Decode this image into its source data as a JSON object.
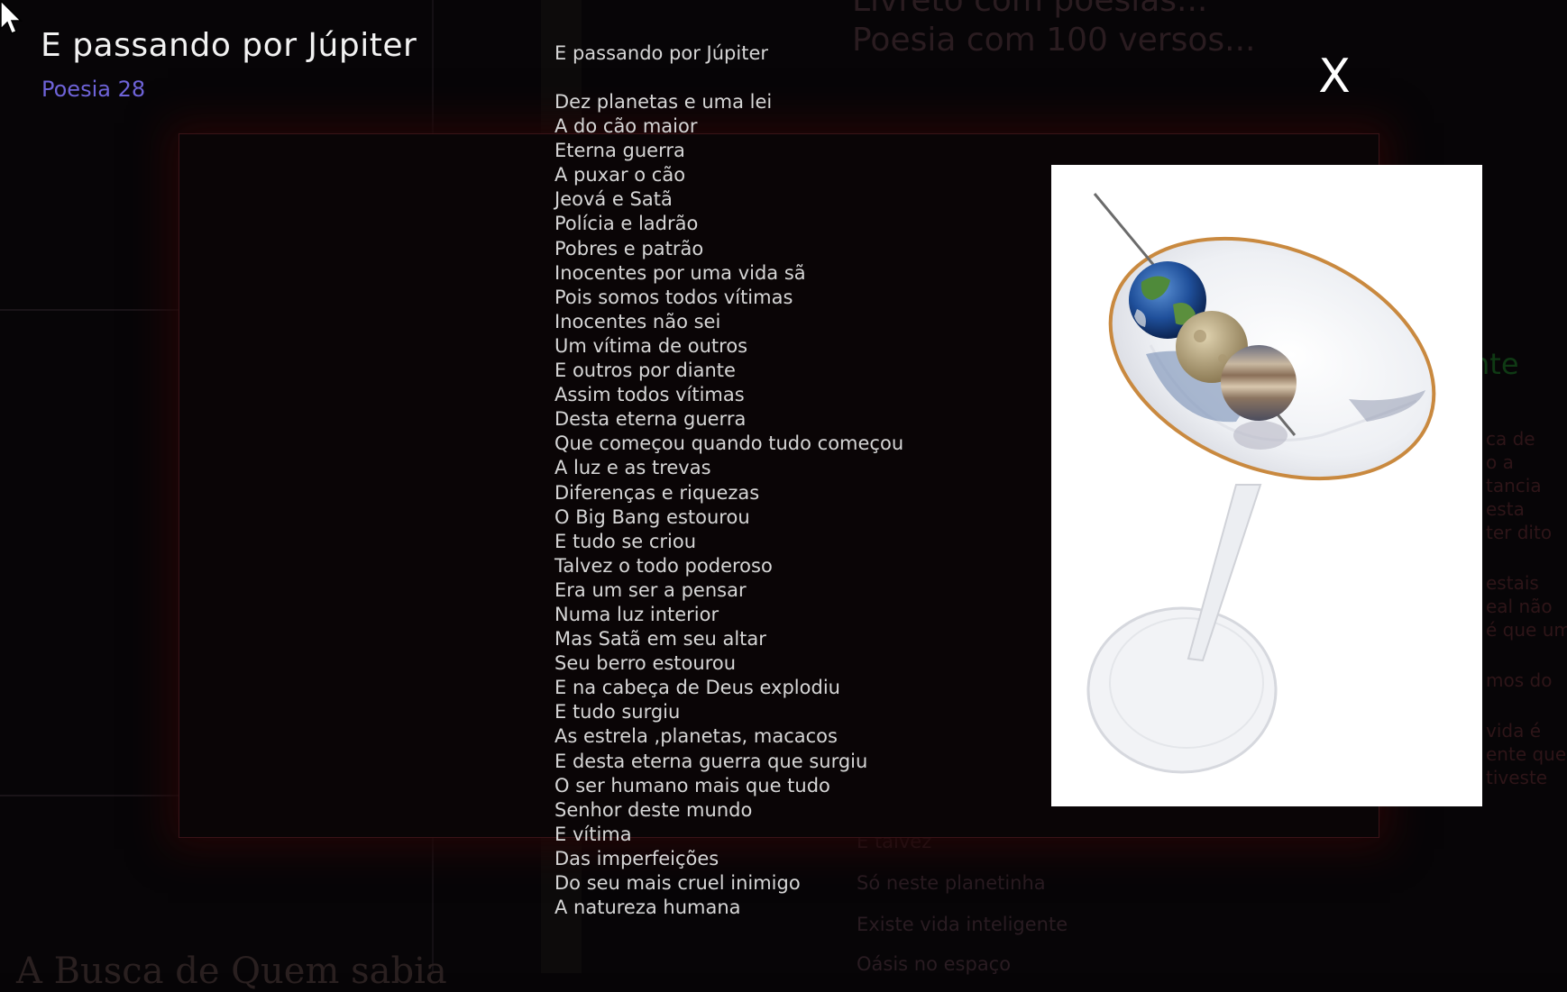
{
  "header": {
    "title": "E passando por Júpiter",
    "subtitle": "Poesia 28"
  },
  "close_button": {
    "label": "X"
  },
  "poem": {
    "title": "E passando por Júpiter",
    "lines": [
      "Dez planetas e uma lei",
      "A do cão maior",
      "Eterna guerra",
      "A puxar o cão",
      "Jeová e Satã",
      "Polícia e ladrão",
      "Pobres e patrão",
      "Inocentes por uma vida sã",
      "Pois somos todos vítimas",
      "Inocentes não sei",
      "Um vítima de outros",
      "E outros por diante",
      "Assim todos vítimas",
      "Desta eterna guerra",
      "Que começou quando tudo começou",
      "A luz e as trevas",
      "Diferenças e riquezas",
      "O Big Bang estourou",
      "E tudo se criou",
      "Talvez o todo poderoso",
      "Era um ser a pensar",
      "Numa luz interior",
      "Mas Satã em seu altar",
      "Seu berro estourou",
      "E na cabeça de Deus explodiu",
      "E tudo surgiu",
      "As estrela ,planetas, macacos",
      "E desta eterna guerra que surgiu",
      "O ser humano mais que tudo",
      "Senhor deste mundo",
      "E vítima",
      "Das imperfeições",
      "Do seu mais cruel inimigo",
      "A natureza humana"
    ]
  },
  "background": {
    "heading_line1": "Livreto com poesias...",
    "heading_line2": "Poesia com 100 versos...",
    "green_word": "nte",
    "lower_lines": [
      "E talvez",
      "Só neste planetinha",
      "Existe vida inteligente",
      "Oásis no espaço"
    ],
    "bottom_title": "A Busca de Quem sabia",
    "side_fragments": [
      "ca de",
      "o a",
      "tancia",
      "esta",
      "ter dito",
      "estais",
      "eal não",
      "é que um",
      "mos do",
      "vida é",
      "ente que",
      "tiveste"
    ]
  },
  "colors": {
    "title": "#f2f2f2",
    "subtitle": "#6e63d8",
    "poem_text": "#d6d6d6",
    "panel_border": "#3a1418",
    "background": "#060406"
  },
  "icons": [
    "cursor-arrow-icon",
    "close-icon",
    "planets-martini-artwork"
  ]
}
